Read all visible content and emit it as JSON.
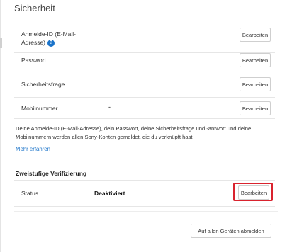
{
  "section_title": "Sicherheit",
  "rows": [
    {
      "label": "Anmelde-ID (E-Mail-Adresse)",
      "value": "",
      "edit_label": "Bearbeiten",
      "has_help": true
    },
    {
      "label": "Passwort",
      "value": "",
      "edit_label": "Bearbeiten"
    },
    {
      "label": "Sicherheitsfrage",
      "value": "",
      "edit_label": "Bearbeiten"
    },
    {
      "label": "Mobilnummer",
      "value": "-",
      "edit_label": "Bearbeiten"
    }
  ],
  "help_icon": "question-mark-icon",
  "info_text": "Deine Anmelde-ID (E-Mail-Adresse), dein Passwort, deine Sicherheitsfrage und -antwort und deine Mobilnummern werden allen Sony-Konten gemeldet, die du verknüpft hast",
  "more_link": "Mehr erfahren",
  "two_step": {
    "title": "Zweistufige Verifizierung",
    "status_label": "Status",
    "status_value": "Deaktiviert",
    "edit_label": "Bearbeiten",
    "highlight_color": "#d9232e"
  },
  "signout_all_label": "Auf allen Geräten abmelden",
  "colors": {
    "link": "#1a73c9",
    "highlight": "#d9232e"
  }
}
